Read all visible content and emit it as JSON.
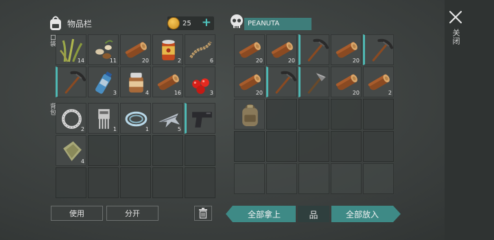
{
  "header": {
    "inventory_title": "物品栏",
    "coins": "25",
    "coin_plus": "+",
    "container_name": "PEANUTA",
    "close_label": "关闭"
  },
  "labels": {
    "quick": "口袋",
    "backpack": "背包"
  },
  "quick_slots": [
    {
      "icon": "grass-icon",
      "count": "14"
    },
    {
      "icon": "seeds-icon",
      "count": "11"
    },
    {
      "icon": "log-icon",
      "count": "20"
    },
    {
      "icon": "canned-food-icon",
      "count": "2"
    },
    {
      "icon": "rope-icon",
      "count": "6"
    },
    {
      "icon": "pickaxe-icon",
      "count": ""
    },
    {
      "icon": "water-bottle-icon",
      "count": "3"
    },
    {
      "icon": "jar-icon",
      "count": "4"
    },
    {
      "icon": "log-icon",
      "count": "16"
    },
    {
      "icon": "berries-icon",
      "count": "3"
    }
  ],
  "backpack_slots": [
    {
      "icon": "ring-icon",
      "count": "2"
    },
    {
      "icon": "circuit-icon",
      "count": "1"
    },
    {
      "icon": "wire-coil-icon",
      "count": "1"
    },
    {
      "icon": "airplane-part-icon",
      "count": "5"
    },
    {
      "icon": "pistol-icon",
      "count": ""
    },
    {
      "icon": "cloth-icon",
      "count": "4"
    },
    {
      "icon": "",
      "count": ""
    },
    {
      "icon": "",
      "count": ""
    },
    {
      "icon": "",
      "count": ""
    },
    {
      "icon": "",
      "count": ""
    },
    {
      "icon": "",
      "count": ""
    },
    {
      "icon": "",
      "count": ""
    },
    {
      "icon": "",
      "count": ""
    },
    {
      "icon": "",
      "count": ""
    },
    {
      "icon": "",
      "count": ""
    }
  ],
  "container_slots": [
    {
      "icon": "log-icon",
      "count": "20"
    },
    {
      "icon": "log-icon",
      "count": "20"
    },
    {
      "icon": "pickaxe-icon",
      "count": ""
    },
    {
      "icon": "log-icon",
      "count": "20"
    },
    {
      "icon": "pickaxe-icon",
      "count": ""
    },
    {
      "icon": "log-icon",
      "count": "20"
    },
    {
      "icon": "pickaxe-icon",
      "count": ""
    },
    {
      "icon": "stone-pickaxe-icon",
      "count": ""
    },
    {
      "icon": "log-icon",
      "count": "20"
    },
    {
      "icon": "log-icon",
      "count": "2"
    },
    {
      "icon": "backpack-icon",
      "count": ""
    },
    {
      "icon": "",
      "count": ""
    },
    {
      "icon": "",
      "count": ""
    },
    {
      "icon": "",
      "count": ""
    },
    {
      "icon": "",
      "count": ""
    },
    {
      "icon": "",
      "count": ""
    },
    {
      "icon": "",
      "count": ""
    },
    {
      "icon": "",
      "count": ""
    },
    {
      "icon": "",
      "count": ""
    },
    {
      "icon": "",
      "count": ""
    },
    {
      "icon": "",
      "count": ""
    },
    {
      "icon": "",
      "count": ""
    },
    {
      "icon": "",
      "count": ""
    },
    {
      "icon": "",
      "count": ""
    },
    {
      "icon": "",
      "count": ""
    }
  ],
  "buttons": {
    "use": "使用",
    "split": "分开",
    "take_all": "全部拿上",
    "sort": "品",
    "put_all": "全部放入"
  },
  "colors": {
    "accent": "#3e8a86",
    "accent_light": "#4fc6c0"
  }
}
